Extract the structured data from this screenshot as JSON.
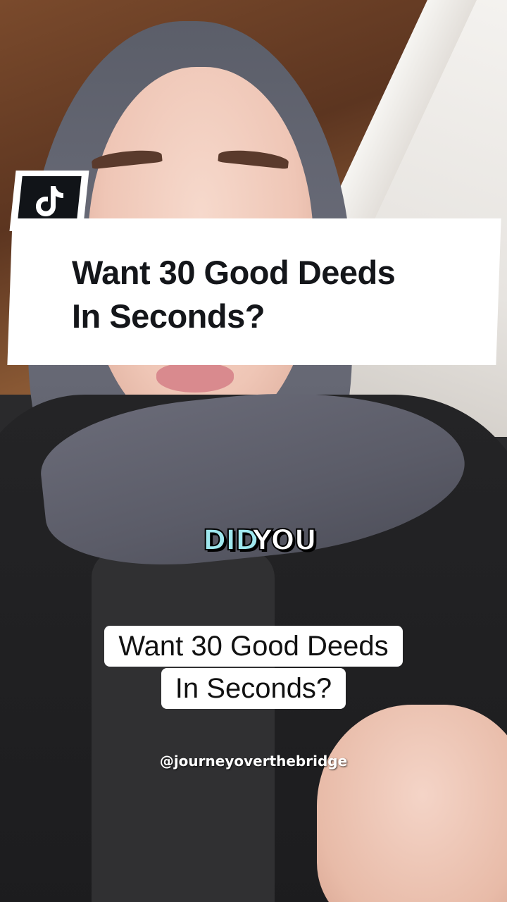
{
  "app": {
    "logo_icon": "tiktok-logo-icon"
  },
  "title_card": {
    "line1": "Want 30 Good Deeds",
    "line2": "In Seconds?"
  },
  "caption": {
    "word1": "DID",
    "word2": "YOU",
    "highlight_color": "#9fe7ee"
  },
  "subtitle": {
    "line1": "Want 30 Good Deeds",
    "line2": "In Seconds?"
  },
  "creator": {
    "handle": "@journeyoverthebridge"
  }
}
